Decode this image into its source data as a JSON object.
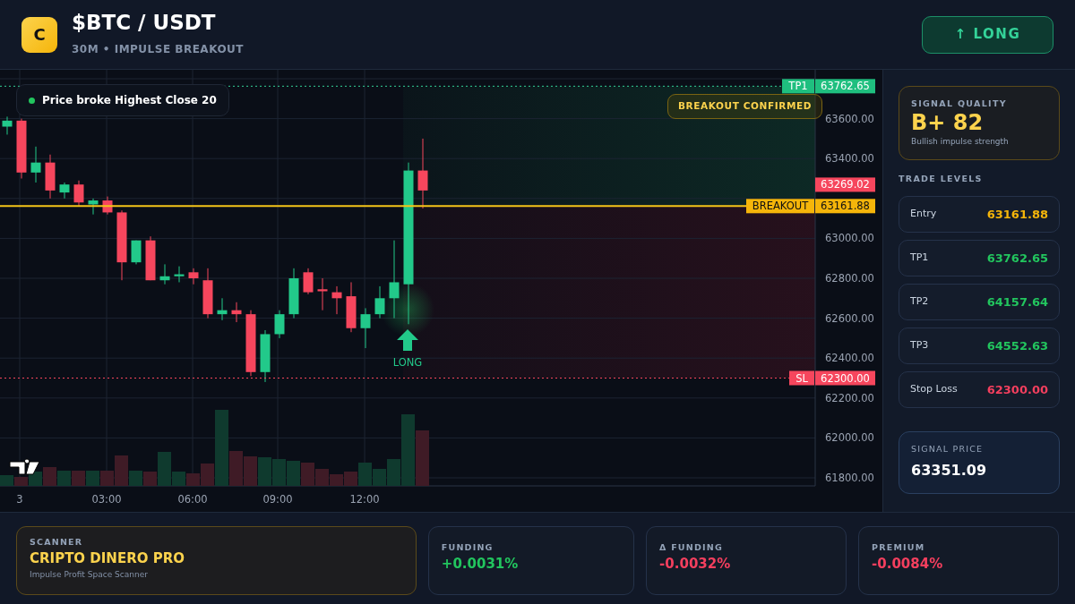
{
  "header": {
    "logo_letter": "C",
    "title": "$BTC / USDT",
    "subtitle": "30M • IMPULSE BREAKOUT",
    "action": {
      "label": "↑ LONG",
      "kind": "long"
    }
  },
  "chart": {
    "notice": "Price broke Highest Close 20",
    "badge": "BREAKOUT CONFIRMED",
    "signal": {
      "label": "LONG",
      "kind": "long"
    },
    "price_ticks": [
      "63600.00",
      "63400.00",
      "63000.00",
      "62800.00",
      "62600.00",
      "62400.00",
      "62200.00",
      "62000.00",
      "61800.00"
    ],
    "time_ticks": [
      "3",
      "03:00",
      "06:00",
      "09:00",
      "12:00"
    ],
    "tags": [
      {
        "kind": "tp",
        "label": "TP1",
        "value": "63762.65"
      },
      {
        "kind": "last",
        "value": "63269.02"
      },
      {
        "kind": "breakout",
        "label": "BREAKOUT",
        "value": "63161.88"
      },
      {
        "kind": "sl",
        "label": "SL",
        "value": "62300.00"
      }
    ]
  },
  "sidebar": {
    "quality": {
      "label": "SIGNAL QUALITY",
      "grade": "B+ 82",
      "note": "Bullish impulse strength"
    },
    "levels_title": "TRADE LEVELS",
    "levels": [
      {
        "label": "Entry",
        "value": "63161.88",
        "kind": "entry"
      },
      {
        "label": "TP1",
        "value": "63762.65",
        "kind": "target"
      },
      {
        "label": "TP2",
        "value": "64157.64",
        "kind": "target"
      },
      {
        "label": "TP3",
        "value": "64552.63",
        "kind": "target"
      },
      {
        "label": "Stop Loss",
        "value": "62300.00",
        "kind": "stop"
      }
    ],
    "signal_price": {
      "label": "SIGNAL PRICE",
      "value": "63351.09"
    }
  },
  "stats": [
    {
      "kind": "scanner",
      "label": "SCANNER",
      "value": "CRIPTO DINERO PRO",
      "note": "Impulse Profit Space Scanner"
    },
    {
      "kind": "positive",
      "label": "FUNDING",
      "value": "+0.0031%"
    },
    {
      "kind": "negative",
      "label": "Δ FUNDING",
      "value": "-0.0032%"
    },
    {
      "kind": "negative",
      "label": "PREMIUM",
      "value": "-0.0084%"
    }
  ]
}
